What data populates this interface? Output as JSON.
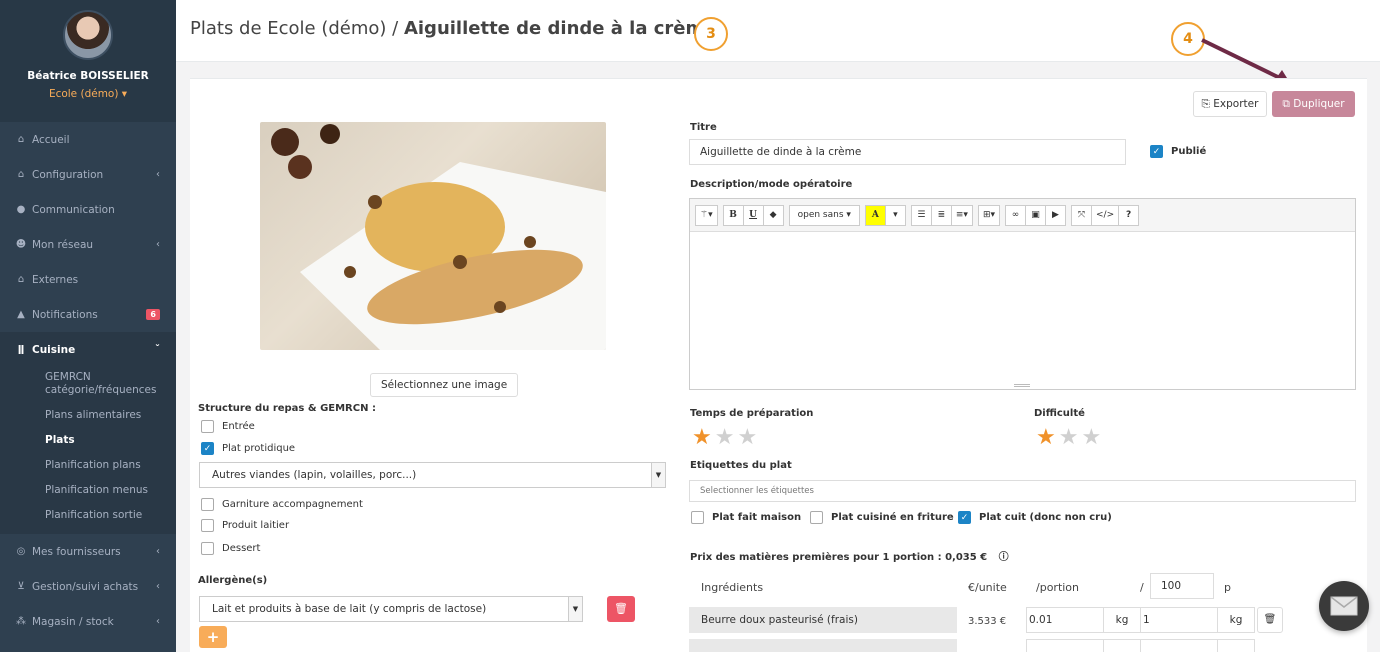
{
  "user": {
    "name": "Béatrice BOISSELIER",
    "school": "Ecole (démo) ▾"
  },
  "nav": {
    "accueil": "Accueil",
    "configuration": "Configuration",
    "communication": "Communication",
    "reseau": "Mon réseau",
    "externes": "Externes",
    "notifications": "Notifications",
    "notifications_count": "6",
    "cuisine": "Cuisine",
    "cuisine_sub": [
      "GEMRCN catégorie/fréquences",
      "Plans alimentaires",
      "Plats",
      "Planification plans",
      "Planification menus",
      "Planification sortie"
    ],
    "fournisseurs": "Mes fournisseurs",
    "achats": "Gestion/suivi achats",
    "magasin": "Magasin / stock"
  },
  "header": {
    "breadcrumb": "Plats de Ecole (démo) / ",
    "title": "Aiguillette de dinde à la crème"
  },
  "steps": {
    "step3": "3",
    "step4": "4"
  },
  "actions": {
    "export": "Exporter",
    "duplicate": "Dupliquer"
  },
  "image_button": "Sélectionnez une image",
  "structure": {
    "label": "Structure du repas & GEMRCN :",
    "entree": "Entrée",
    "plat_protidique": "Plat protidique",
    "viande_select": "Autres viandes (lapin, volailles, porc...)",
    "garniture": "Garniture accompagnement",
    "produit_laitier": "Produit laitier",
    "dessert": "Dessert"
  },
  "allergenes": {
    "label": "Allergène(s)",
    "value": "Lait et produits à base de lait (y compris de lactose)"
  },
  "form": {
    "titre_label": "Titre",
    "titre_value": "Aiguillette de dinde à la crème",
    "publie": "Publié",
    "description_label": "Description/mode opératoire",
    "font_select": "open sans ▾"
  },
  "ratings": {
    "prep_label": "Temps de préparation",
    "prep_value": 1,
    "difficulty_label": "Difficulté",
    "difficulty_value": 1,
    "max": 3
  },
  "tags": {
    "label": "Etiquettes du plat",
    "placeholder": "Selectionner les étiquettes",
    "fait_maison": "Plat fait maison",
    "friture": "Plat cuisiné en friture",
    "cuit": "Plat cuit (donc non cru)"
  },
  "prix": {
    "label": "Prix des matières premières pour 1 portion : 0,035 €",
    "col_ingredients": "Ingrédients",
    "col_unite": "€/unite",
    "col_portion": "/portion",
    "col_slash": "/",
    "col_p_value": "100",
    "col_p": "p",
    "rows": [
      {
        "name": "Beurre doux pasteurisé (frais)",
        "price": "3.533 €",
        "portion": "0.01",
        "unit1": "kg",
        "qty": "1",
        "unit2": "kg"
      }
    ]
  },
  "colors": {
    "sidebar": "#2f4050",
    "accent_orange": "#f8ac59",
    "danger": "#ed5565",
    "duplicate": "#c7879a",
    "arrow": "#6e2a46"
  }
}
